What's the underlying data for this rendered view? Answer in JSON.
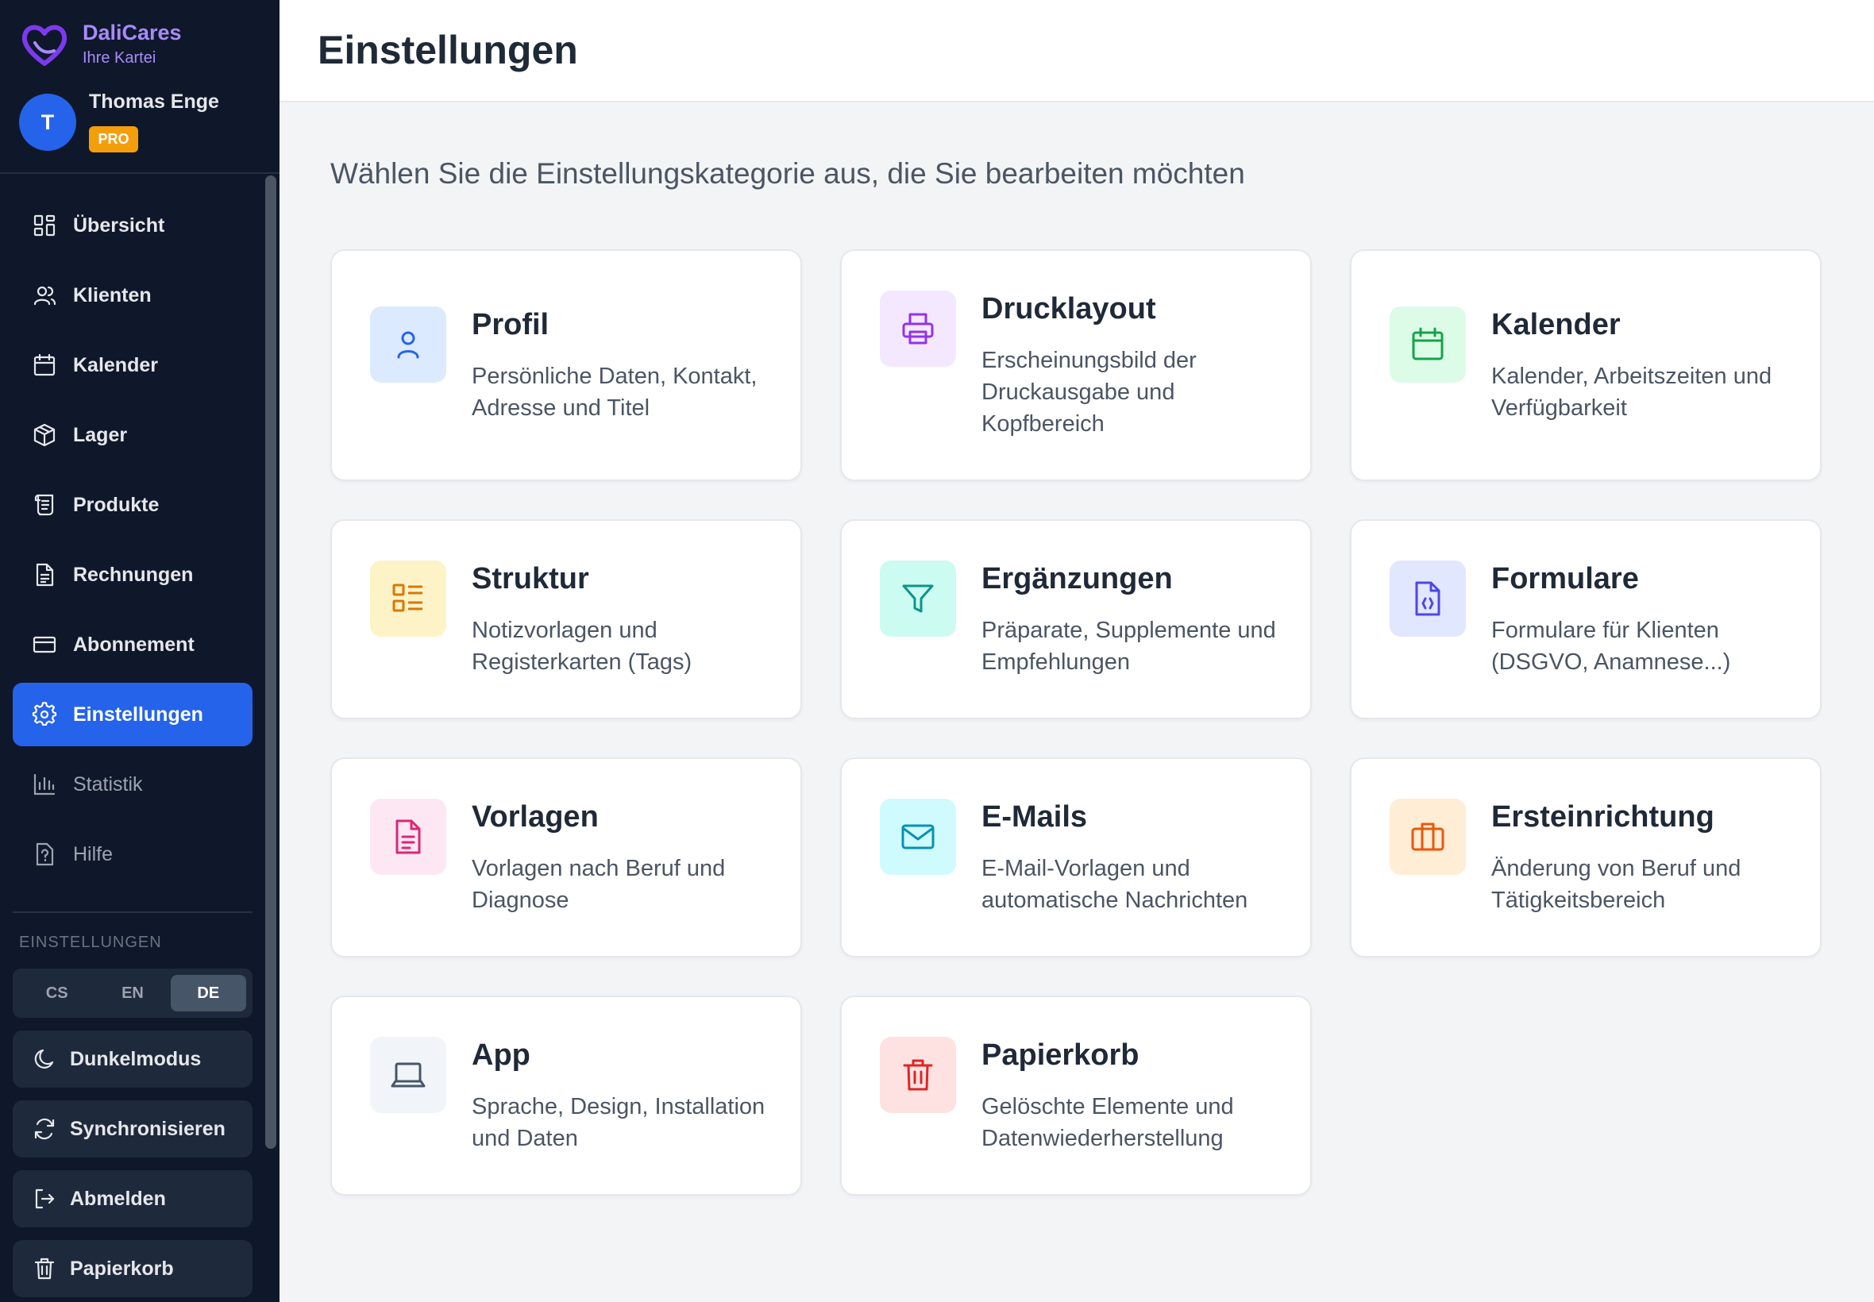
{
  "brand": {
    "name": "DaliCares",
    "subtitle": "Ihre Kartei"
  },
  "user": {
    "initial": "T",
    "name": "Thomas Enge",
    "badge": "PRO"
  },
  "nav": [
    {
      "label": "Übersicht",
      "icon": "dashboard-icon"
    },
    {
      "label": "Klienten",
      "icon": "users-icon"
    },
    {
      "label": "Kalender",
      "icon": "calendar-icon"
    },
    {
      "label": "Lager",
      "icon": "package-icon"
    },
    {
      "label": "Produkte",
      "icon": "scroll-icon"
    },
    {
      "label": "Rechnungen",
      "icon": "document-icon"
    },
    {
      "label": "Abonnement",
      "icon": "credit-card-icon"
    },
    {
      "label": "Einstellungen",
      "icon": "gear-icon",
      "active": true
    },
    {
      "label": "Statistik",
      "icon": "bar-chart-icon"
    },
    {
      "label": "Hilfe",
      "icon": "help-icon"
    }
  ],
  "settings_section": {
    "title": "EINSTELLUNGEN",
    "languages": [
      "CS",
      "EN",
      "DE"
    ],
    "active_language": "DE",
    "actions": [
      {
        "label": "Dunkelmodus",
        "icon": "moon-icon"
      },
      {
        "label": "Synchronisieren",
        "icon": "sync-icon"
      },
      {
        "label": "Abmelden",
        "icon": "logout-icon"
      },
      {
        "label": "Papierkorb",
        "icon": "trash-icon"
      }
    ]
  },
  "page": {
    "title": "Einstellungen",
    "intro": "Wählen Sie die Einstellungskategorie aus, die Sie bearbeiten möchten"
  },
  "cards": [
    {
      "title": "Profil",
      "desc": "Persönliche Daten, Kontakt, Adresse und Titel",
      "icon": "user-icon",
      "color": "#2563eb",
      "bg": "#dbeafe"
    },
    {
      "title": "Drucklayout",
      "desc": "Erscheinungsbild der Druckausgabe und Kopfbereich",
      "icon": "printer-icon",
      "color": "#9333ea",
      "bg": "#f3e8ff"
    },
    {
      "title": "Kalender",
      "desc": "Kalender, Arbeitszeiten und Verfügbarkeit",
      "icon": "calendar-icon",
      "color": "#16a34a",
      "bg": "#dcfce7"
    },
    {
      "title": "Struktur",
      "desc": "Notizvorlagen und Registerkarten (Tags)",
      "icon": "list-icon",
      "color": "#d97706",
      "bg": "#fef3c7"
    },
    {
      "title": "Ergänzungen",
      "desc": "Präparate, Supplemente und Empfehlungen",
      "icon": "filter-icon",
      "color": "#0d9488",
      "bg": "#ccfbf1"
    },
    {
      "title": "Formulare",
      "desc": "Formulare für Klienten (DSGVO, Anamnese...)",
      "icon": "form-file-icon",
      "color": "#4f46e5",
      "bg": "#e0e7ff"
    },
    {
      "title": "Vorlagen",
      "desc": "Vorlagen nach Beruf und Diagnose",
      "icon": "template-icon",
      "color": "#db2777",
      "bg": "#fce7f3"
    },
    {
      "title": "E-Mails",
      "desc": "E-Mail-Vorlagen und automatische Nachrichten",
      "icon": "mail-icon",
      "color": "#0891b2",
      "bg": "#cffafe"
    },
    {
      "title": "Ersteinrichtung",
      "desc": "Änderung von Beruf und Tätigkeitsbereich",
      "icon": "briefcase-icon",
      "color": "#ea580c",
      "bg": "#ffedd5"
    },
    {
      "title": "App",
      "desc": "Sprache, Design, Installation und Daten",
      "icon": "laptop-icon",
      "color": "#475569",
      "bg": "#f1f5f9"
    },
    {
      "title": "Papierkorb",
      "desc": "Gelöschte Elemente und Datenwiederherstellung",
      "icon": "trash-icon",
      "color": "#dc2626",
      "bg": "#fee2e2"
    }
  ]
}
